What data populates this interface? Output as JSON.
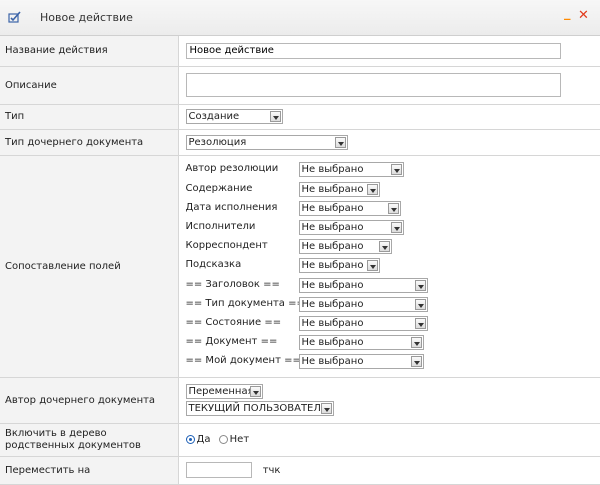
{
  "window": {
    "title": "Новое действие",
    "minimize": "_",
    "close": "✕",
    "icon": "action-icon"
  },
  "fields": {
    "action_name": {
      "label": "Название действия",
      "value": "Новое действие"
    },
    "description": {
      "label": "Описание",
      "value": ""
    },
    "type": {
      "label": "Тип",
      "value": "Создание"
    },
    "child_doc_type": {
      "label": "Тип дочернего документа",
      "value": "Резолюция"
    },
    "field_mapping": {
      "label": "Сопоставление полей",
      "rows": [
        {
          "name": "Автор резолюции",
          "value": "Не выбрано"
        },
        {
          "name": "Содержание",
          "value": "Не выбрано"
        },
        {
          "name": "Дата исполнения",
          "value": "Не выбрано"
        },
        {
          "name": "Исполнители",
          "value": "Не выбрано"
        },
        {
          "name": "Корреспондент",
          "value": "Не выбрано"
        },
        {
          "name": "Подсказка",
          "value": "Не выбрано"
        },
        {
          "name": "== Заголовок ==",
          "value": "Не выбрано"
        },
        {
          "name": "== Тип документа ==",
          "value": "Не выбрано"
        },
        {
          "name": "== Состояние ==",
          "value": "Не выбрано"
        },
        {
          "name": "== Документ ==",
          "value": "Не выбрано"
        },
        {
          "name": "== Мой документ ==",
          "value": "Не выбрано"
        }
      ]
    },
    "child_doc_author": {
      "label": "Автор дочернего документа",
      "mode": "Переменная",
      "value": "ТЕКУЩИЙ ПОЛЬЗОВАТЕЛЬ"
    },
    "include_related": {
      "label": "Включить в дерево родственных документов",
      "yes": "Да",
      "no": "Нет",
      "selected": "yes"
    },
    "move_to": {
      "label": "Переместить на",
      "value": "",
      "unit": "тчк"
    }
  }
}
